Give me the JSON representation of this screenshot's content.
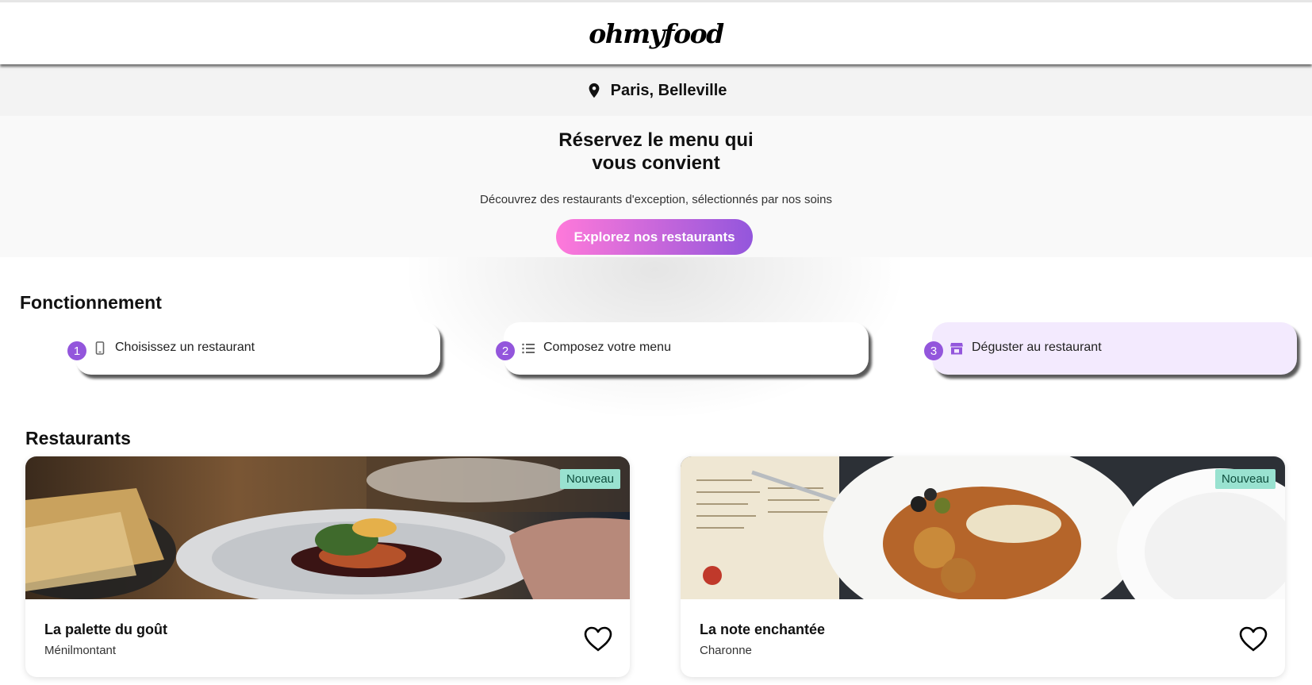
{
  "header": {
    "logo": "ohmyfood"
  },
  "location": {
    "icon": "map-pin-icon",
    "text": "Paris, Belleville"
  },
  "hero": {
    "title_line1": "Réservez le menu qui",
    "title_line2": "vous convient",
    "subtitle": "Découvrez des restaurants d'exception, sélectionnés par nos soins",
    "cta_label": "Explorez nos restaurants"
  },
  "how_it_works": {
    "title": "Fonctionnement",
    "steps": [
      {
        "number": "1",
        "icon": "smartphone-icon",
        "label": "Choisissez un restaurant"
      },
      {
        "number": "2",
        "icon": "list-icon",
        "label": "Composez votre menu"
      },
      {
        "number": "3",
        "icon": "storefront-icon",
        "label": "Déguster au restaurant"
      }
    ]
  },
  "restaurants": {
    "title": "Restaurants",
    "items": [
      {
        "name": "La palette du goût",
        "neighborhood": "Ménilmontant",
        "badge": "Nouveau",
        "favorite_icon": "heart-outline-icon"
      },
      {
        "name": "La note enchantée",
        "neighborhood": "Charonne",
        "badge": "Nouveau",
        "favorite_icon": "heart-outline-icon"
      }
    ]
  },
  "colors": {
    "accent_pink": "#ff79da",
    "accent_purple": "#9356dc",
    "highlight_bg": "#f3eafe",
    "badge_bg": "#99e2d0"
  }
}
